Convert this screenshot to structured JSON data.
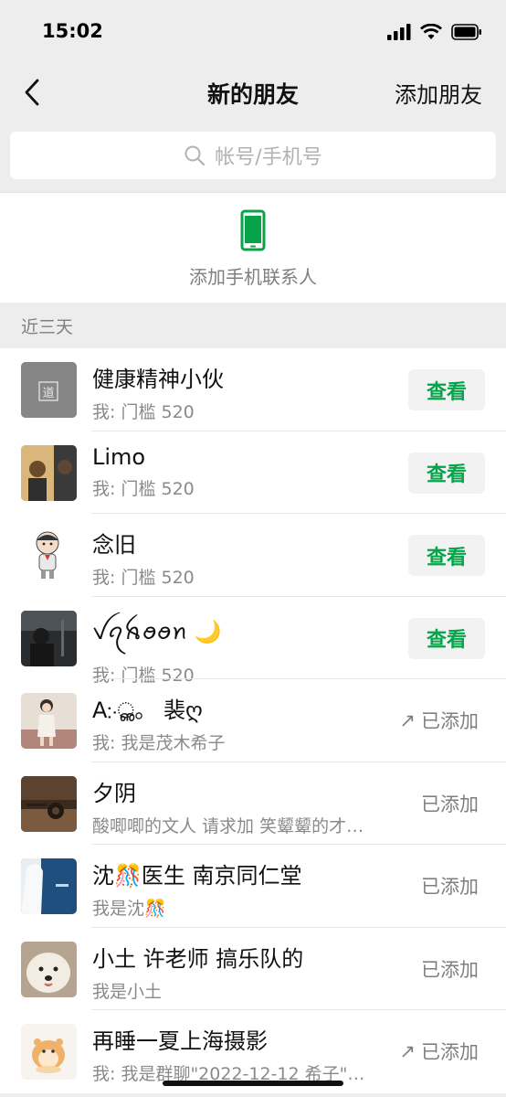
{
  "status_bar": {
    "time": "15:02"
  },
  "nav": {
    "title": "新的朋友",
    "action_label": "添加朋友"
  },
  "search": {
    "placeholder": "帐号/手机号"
  },
  "add_contacts": {
    "label": "添加手机联系人"
  },
  "section_title": "近三天",
  "colors": {
    "accent_green": "#07a34a",
    "background": "#ededed"
  },
  "requests": [
    {
      "name": "健康精神小伙",
      "message": "我: 门槛 520",
      "status": "查看",
      "avatar_icon": "avatar-stamp"
    },
    {
      "name": "Limo",
      "message": "我: 门槛 520",
      "status": "查看",
      "avatar_icon": "avatar-photo"
    },
    {
      "name": "念旧",
      "message": "我: 门槛 520",
      "status": "查看",
      "avatar_icon": "avatar-cartoon-child"
    },
    {
      "name": "ꪜꪖꫝꪮꪮꪀ 🌙",
      "message": "我: 门槛 520",
      "status": "查看",
      "avatar_icon": "avatar-dark-photo"
    },
    {
      "name": "A჻ൢ。 裴ღ",
      "message": "我: 我是茂木希子",
      "status": "已添加",
      "status_prefix": "↗",
      "avatar_icon": "avatar-girl-photo"
    },
    {
      "name": "夕阴",
      "message": "酸唧唧的文人 请求加 笑颦颦的才…",
      "status": "已添加",
      "avatar_icon": "avatar-sepia-photo"
    },
    {
      "name": "沈🎊医生 南京同仁堂",
      "message": "我是沈🎊",
      "status": "已添加",
      "avatar_icon": "avatar-blue-photo"
    },
    {
      "name": "小土 许老师 搞乐队的",
      "message": "我是小土",
      "status": "已添加",
      "avatar_icon": "avatar-dog"
    },
    {
      "name": "再睡一夏上海摄影",
      "message": "我: 我是群聊\"2022-12-12 希子\"…",
      "status": "已添加",
      "status_prefix": "↗",
      "avatar_icon": "avatar-hamster"
    }
  ]
}
